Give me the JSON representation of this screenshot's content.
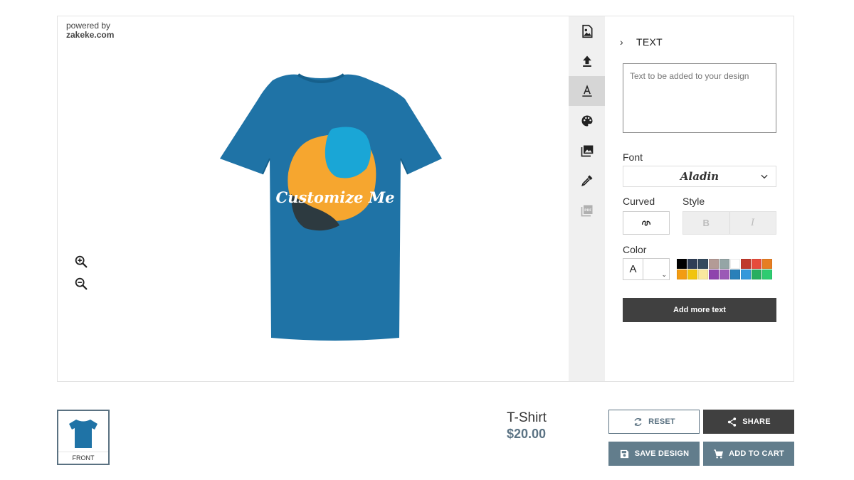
{
  "editor": {
    "powered_by": "powered by",
    "brand": "zakeke.com",
    "design_text": "Customize Me",
    "zoom": [
      {
        "name": "zoom-in-icon"
      },
      {
        "name": "zoom-out-icon"
      }
    ],
    "colors": {
      "shirt": "#1f73a6",
      "blob_orange": "#f6a62f",
      "blob_blue": "#1aa6d6",
      "blob_dark": "#2d3a40"
    }
  },
  "toolbar": {
    "tools": [
      {
        "icon": "image-icon",
        "active": false
      },
      {
        "icon": "upload-icon",
        "active": false
      },
      {
        "icon": "text-icon",
        "active": true
      },
      {
        "icon": "palette-icon",
        "active": false
      },
      {
        "icon": "gallery-icon",
        "active": false
      },
      {
        "icon": "eyedropper-icon",
        "active": false
      },
      {
        "icon": "pdf-icon",
        "active": false
      }
    ]
  },
  "panel": {
    "title": "TEXT",
    "text_placeholder": "Text to be added to your design",
    "font_label": "Font",
    "font_value": "Aladin",
    "curved_label": "Curved",
    "style_label": "Style",
    "bold_label": "B",
    "italic_label": "I",
    "color_label": "Color",
    "color_letter": "A",
    "swatches": [
      "#000000",
      "#2f3e56",
      "#34495e",
      "#b39b96",
      "#95a5a6",
      "#ffffff",
      "#c0392b",
      "#e74c3c",
      "#e67e22",
      "#f39c12",
      "#f1c40f",
      "#f9e79f",
      "#8e44ad",
      "#9b59b6",
      "#2980b9",
      "#3498db",
      "#27ae60",
      "#2ecc71"
    ],
    "add_more_label": "Add more text"
  },
  "side": {
    "thumb_label": "FRONT"
  },
  "product": {
    "name": "T-Shirt",
    "price": "$20.00"
  },
  "actions": {
    "reset": "RESET",
    "share": "SHARE",
    "save": "SAVE DESIGN",
    "cart": "ADD TO CART"
  }
}
